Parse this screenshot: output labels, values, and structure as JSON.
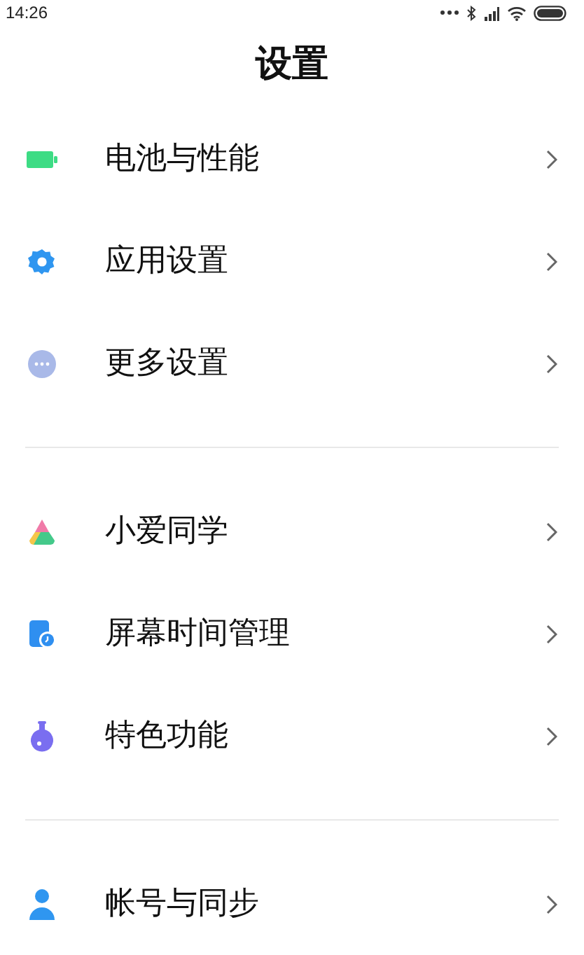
{
  "status_bar": {
    "time": "14:26"
  },
  "title": "设置",
  "groups": [
    {
      "items": [
        {
          "label": "电池与性能"
        },
        {
          "label": "应用设置"
        },
        {
          "label": "更多设置"
        }
      ]
    },
    {
      "items": [
        {
          "label": "小爱同学"
        },
        {
          "label": "屏幕时间管理"
        },
        {
          "label": "特色功能"
        }
      ]
    },
    {
      "items": [
        {
          "label": "帐号与同步"
        }
      ]
    }
  ]
}
